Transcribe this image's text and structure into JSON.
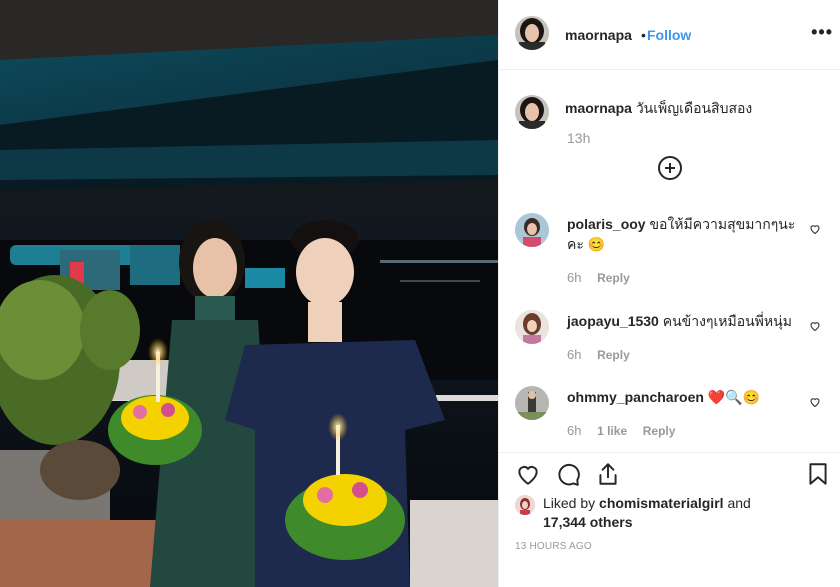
{
  "post": {
    "username": "maornapa",
    "separator": "•",
    "follow_label": "Follow",
    "more_label": "•••",
    "caption": "วันเพ็ญเดือนสิบสอง",
    "caption_time": "13h",
    "liked_by_prefix": "Liked by",
    "liked_by_user": "chomismaterialgirl",
    "liked_by_and": "and",
    "liked_by_others": "17,344 others",
    "post_time": "13 HOURS AGO"
  },
  "comments": [
    {
      "username": "polaris_ooy",
      "text": "ขอให้มีความสุขมากๆนะคะ 😊",
      "time": "6h",
      "likes": "",
      "reply": "Reply"
    },
    {
      "username": "jaopayu_1530",
      "text": "คนข้างๆเหมือนพี่หนุ่ม",
      "time": "6h",
      "likes": "",
      "reply": "Reply"
    },
    {
      "username": "ohmmy_pancharoen",
      "text": "❤️🔍😊",
      "time": "6h",
      "likes": "1 like",
      "reply": "Reply"
    }
  ],
  "icons": [
    "heart-icon",
    "comment-icon",
    "share-icon",
    "bookmark-icon",
    "plus-circle-icon",
    "more-icon"
  ],
  "colors": {
    "follow": "#3897f0",
    "text": "#262626",
    "muted": "#999999",
    "heart": "#ed4956"
  }
}
